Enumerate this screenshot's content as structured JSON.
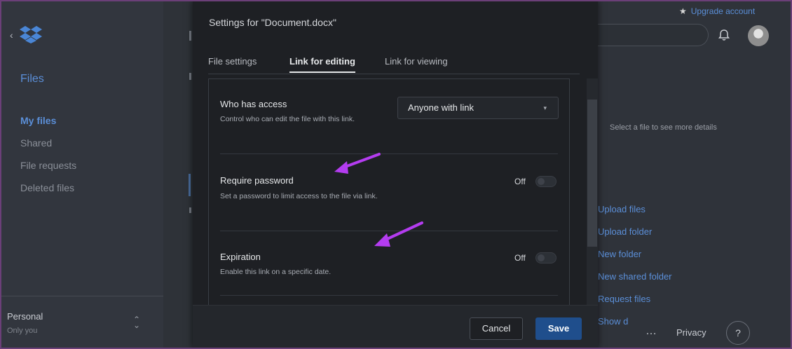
{
  "sidebar": {
    "back_icon": "chevron-left-icon",
    "logo": "dropbox-logo",
    "title": "Files",
    "items": [
      {
        "label": "My files",
        "active": true
      },
      {
        "label": "Shared",
        "active": false
      },
      {
        "label": "File requests",
        "active": false
      },
      {
        "label": "Deleted files",
        "active": false
      }
    ],
    "account": {
      "name": "Personal",
      "sub": "Only you",
      "switch_icon": "up-down-chevron-icon"
    }
  },
  "header": {
    "upgrade_label": "Upgrade account",
    "upgrade_icon": "star-icon",
    "bell_icon": "bell-icon",
    "avatar_icon": "user-avatar"
  },
  "details": {
    "hint": "Select a file to see more details"
  },
  "actions": [
    "Upload files",
    "Upload folder",
    "New folder",
    "New shared folder",
    "Request files",
    "Show d"
  ],
  "footer": {
    "more_label": "…",
    "privacy_label": "Privacy",
    "help_label": "?"
  },
  "modal": {
    "title": "Settings for \"Document.docx\"",
    "tabs": [
      {
        "label": "File settings",
        "active": false
      },
      {
        "label": "Link for editing",
        "active": true
      },
      {
        "label": "Link for viewing",
        "active": false
      }
    ],
    "access": {
      "title": "Who has access",
      "desc": "Control who can edit the file with this link.",
      "selected": "Anyone with link"
    },
    "password": {
      "title": "Require password",
      "desc": "Set a password to limit access to the file via link.",
      "state": "Off"
    },
    "expiration": {
      "title": "Expiration",
      "desc": "Enable this link on a specific date.",
      "state": "Off"
    },
    "cancel_label": "Cancel",
    "save_label": "Save"
  },
  "colors": {
    "accent": "#5b8fd8",
    "save_button": "#1f4e8c",
    "annotation_arrow": "#b43cf0",
    "frame": "#6b3f78"
  }
}
